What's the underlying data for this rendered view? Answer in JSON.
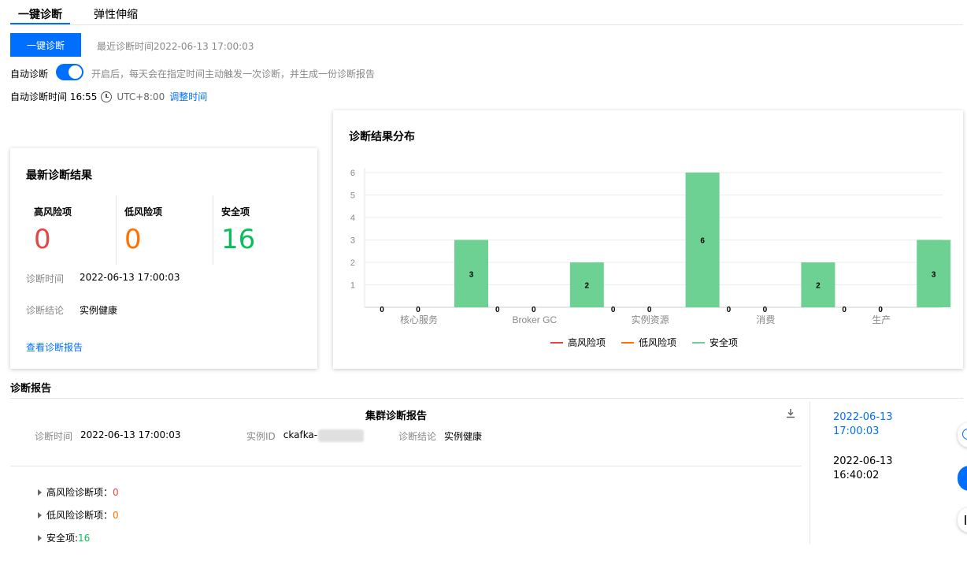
{
  "tabs": [
    {
      "label": "一键诊断",
      "active": true
    },
    {
      "label": "弹性伸缩",
      "active": false
    }
  ],
  "top": {
    "diagnose_button": "一键诊断",
    "last_time": "最近诊断时间2022-06-13 17:00:03",
    "auto_label": "自动诊断",
    "auto_enabled": true,
    "auto_desc": "开启后，每天会在指定时间主动触发一次诊断，并生成一份诊断报告",
    "auto_time_label": "自动诊断时间 16:55",
    "timezone": "UTC+8:00",
    "adjust_link": "调整时间"
  },
  "result": {
    "title": "最新诊断结果",
    "stats": [
      {
        "label": "高风险项",
        "value": "0",
        "color": "#e54545"
      },
      {
        "label": "低风险项",
        "value": "0",
        "color": "#ff7200"
      },
      {
        "label": "安全项",
        "value": "16",
        "color": "#0abf5b"
      }
    ],
    "time_key": "诊断时间",
    "time_value": "2022-06-13 17:00:03",
    "conclusion_key": "诊断结论",
    "conclusion_value": "实例健康",
    "report_link": "查看诊断报告"
  },
  "chart_data": {
    "type": "bar",
    "title": "诊断结果分布",
    "categories": [
      "核心服务",
      "Broker GC",
      "实例资源",
      "消费",
      "生产"
    ],
    "series": [
      {
        "name": "高风险项",
        "values": [
          0,
          0,
          0,
          0,
          0
        ],
        "color": "#e54545"
      },
      {
        "name": "低风险项",
        "values": [
          0,
          0,
          0,
          0,
          0
        ],
        "color": "#ff7200"
      },
      {
        "name": "安全项",
        "values": [
          3,
          2,
          6,
          2,
          3
        ],
        "color": "#6dd193"
      }
    ],
    "yticks": [
      "1",
      "2",
      "3",
      "4",
      "5",
      "6"
    ],
    "ylim": [
      0,
      6
    ],
    "grid": true,
    "legend": "bottom-center"
  },
  "report": {
    "section_title": "诊断报告",
    "title": "集群诊断报告",
    "time_key": "诊断时间",
    "time_value": "2022-06-13 17:00:03",
    "instance_key": "实例ID",
    "instance_value": "ckafka-",
    "conclusion_key": "诊断结论",
    "conclusion_value": "实例健康",
    "items": [
      {
        "label": "高风险诊断项：",
        "count": "0"
      },
      {
        "label": "低风险诊断项：",
        "count": "0"
      },
      {
        "label": "安全项: ",
        "count": "16"
      }
    ],
    "history": [
      {
        "date": "2022-06-13",
        "time": "17:00:03",
        "active": true
      },
      {
        "date": "2022-06-13",
        "time": "16:40:02",
        "active": false
      }
    ]
  }
}
